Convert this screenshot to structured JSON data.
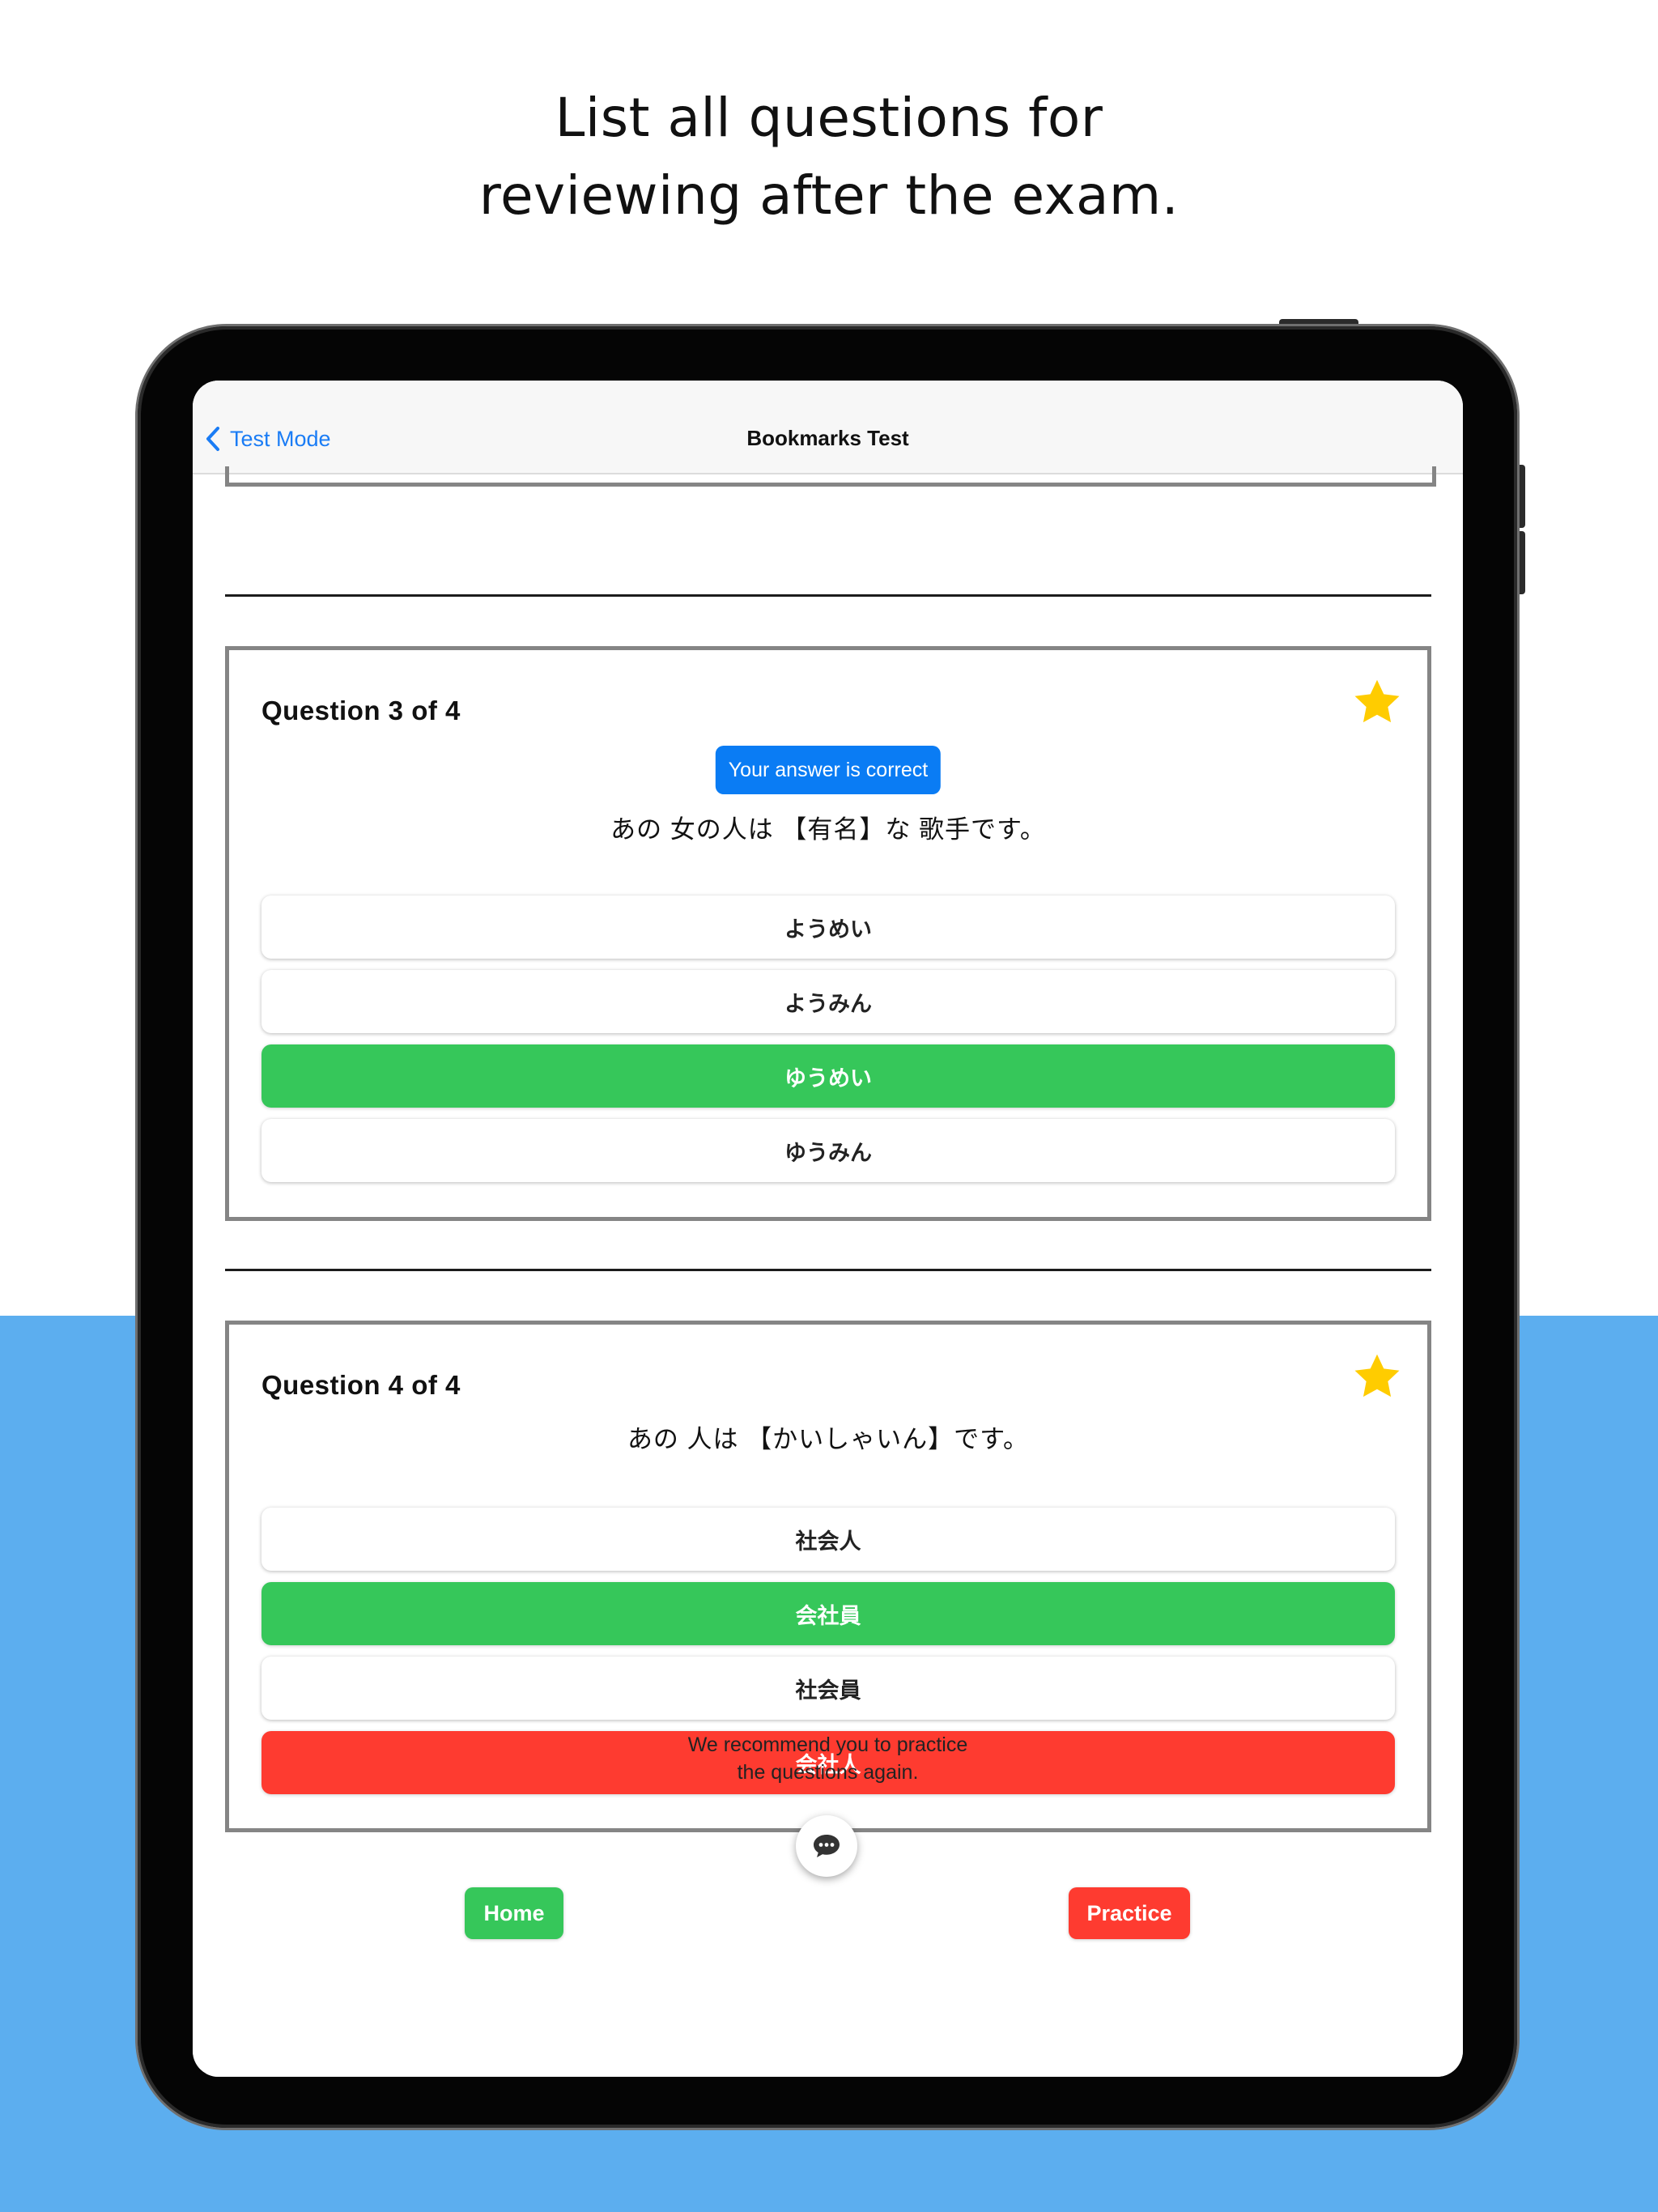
{
  "headline": {
    "line1": "List all questions for",
    "line2": "reviewing after the exam."
  },
  "navbar": {
    "back_label": "Test Mode",
    "title": "Bookmarks Test"
  },
  "questions": [
    {
      "title": "Question  3  of  4",
      "bookmarked": true,
      "status_badge": "Your answer is correct",
      "question_text": "あの 女の人は 【有名】な 歌手です。",
      "options": [
        {
          "label": "ようめい",
          "state": "normal"
        },
        {
          "label": "ようみん",
          "state": "normal"
        },
        {
          "label": "ゆうめい",
          "state": "correct"
        },
        {
          "label": "ゆうみん",
          "state": "normal"
        }
      ]
    },
    {
      "title": "Question  4  of  4",
      "bookmarked": true,
      "question_text": "あの 人は 【かいしゃいん】です。",
      "options": [
        {
          "label": "社会人",
          "state": "normal"
        },
        {
          "label": "会社員",
          "state": "correct"
        },
        {
          "label": "社会員",
          "state": "normal"
        },
        {
          "label": "会社人",
          "state": "wrong"
        }
      ]
    }
  ],
  "footer": {
    "recommend_line1": "We recommend you to practice",
    "recommend_line2": "the questions again.",
    "home_label": "Home",
    "practice_label": "Practice"
  },
  "colors": {
    "accent_blue": "#0a7cf4",
    "correct_green": "#36c75a",
    "wrong_red": "#fe3b30",
    "star_yellow": "#ffcc00",
    "background_blue": "#5caeef"
  },
  "icons": {
    "back": "chevron-left-icon",
    "bookmark": "star-icon",
    "chat": "chat-bubble-icon"
  }
}
